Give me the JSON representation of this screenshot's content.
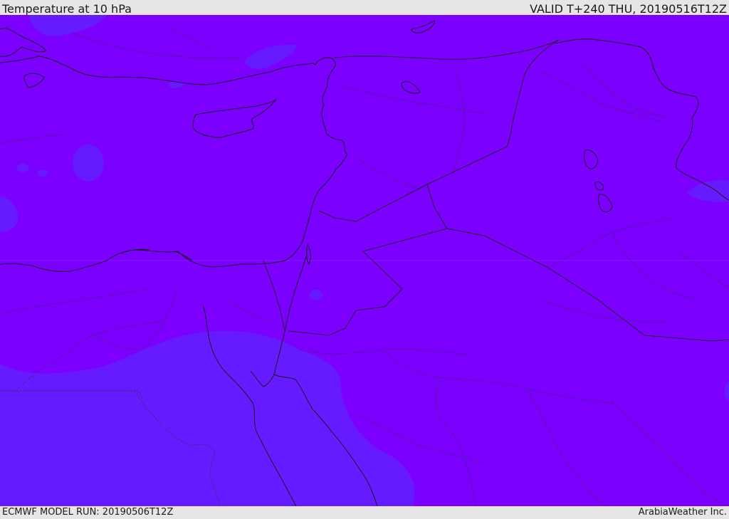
{
  "header": {
    "title": "Temperature at 10 hPa",
    "valid_time": "VALID T+240 THU, 20190516T12Z"
  },
  "footer": {
    "model_run": "ECMWF MODEL RUN: 20190506T12Z",
    "credit": "ArabiaWeather Inc."
  },
  "colors": {
    "field_main": "#7b00ff",
    "field_cooler": "#661aff",
    "coastline": "#1a1a1a",
    "border": "#222222"
  }
}
